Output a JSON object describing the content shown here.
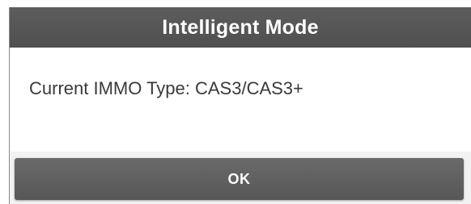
{
  "dialog": {
    "title": "Intelligent Mode",
    "message": "Current IMMO Type: CAS3/CAS3+",
    "ok_label": "OK"
  },
  "colors": {
    "header_background": "#545454",
    "button_background": "#606060",
    "message_text": "#3a3a3a",
    "header_text": "#ffffff"
  }
}
